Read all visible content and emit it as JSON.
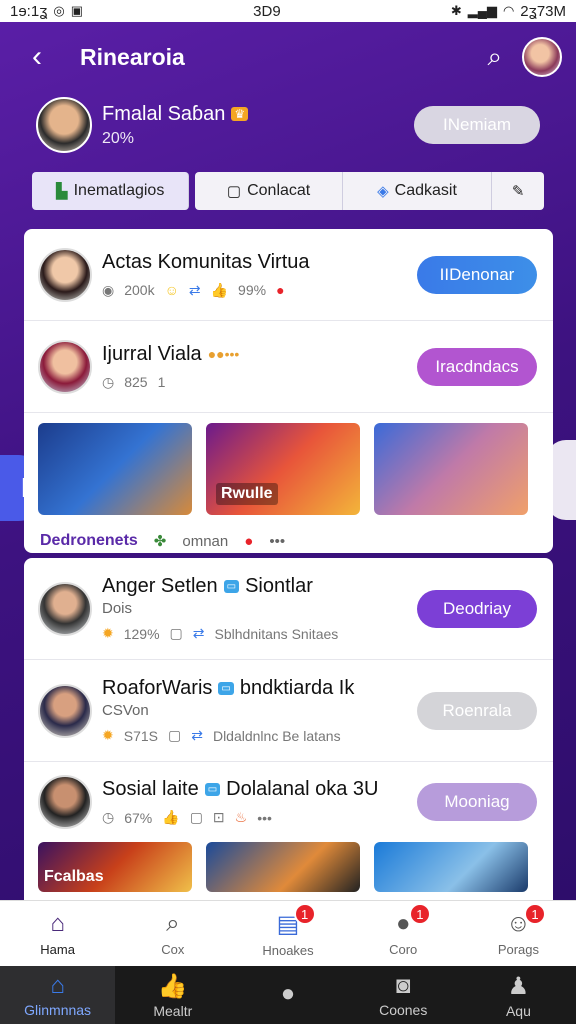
{
  "status": {
    "left": "1ɘ:1ʓ",
    "center": "3D9",
    "right": "2ʓ73M"
  },
  "header": {
    "title": "Rinearoia"
  },
  "profile": {
    "name": "Fmalal Saɓan",
    "sub": "20%",
    "action": "INemiam"
  },
  "tabs": [
    {
      "label": "Inematlagios",
      "icon": "b-icon"
    },
    {
      "label": "Conlacat",
      "icon": "calendar-icon"
    },
    {
      "label": "Cadkasit",
      "icon": "layers-icon"
    },
    {
      "label": "",
      "icon": "edit-icon"
    }
  ],
  "card1": {
    "rows": [
      {
        "title": "Actas Komunitas Virtua",
        "meta": [
          "200k",
          "99%"
        ],
        "action": "IIDenonar",
        "action_color": "blue"
      },
      {
        "title": "Ijurral Viala",
        "meta": [
          "825",
          "1"
        ],
        "action": "Iracdndacs",
        "action_color": "violet"
      }
    ],
    "thumbs": [
      {
        "label": ""
      },
      {
        "label": "Rwulle"
      },
      {
        "label": ""
      }
    ],
    "footer": {
      "strong": "Dedronenets",
      "text": "omnan"
    }
  },
  "card2": {
    "rows": [
      {
        "title": "Anger Setlen",
        "title_b": "Siontlar",
        "sub": "Dois",
        "meta": [
          "129%",
          "Sblhdnitans Snitaes"
        ],
        "action": "Deodriay",
        "action_color": "purple"
      },
      {
        "title": "RoaforWaris",
        "title_b": "bndktiarda Ik",
        "sub": "CSVon",
        "meta": [
          "S71S",
          "Dldaldnlnc Be latans"
        ],
        "action": "Roenrala",
        "action_color": "grey"
      },
      {
        "title": "Sosial laite",
        "title_b": "Dolalanal oka 3U",
        "sub": "",
        "meta": [
          "67%"
        ],
        "action": "Mooniag",
        "action_color": "lilac"
      }
    ],
    "thumbs": [
      {
        "label": "Fcalbas"
      },
      {
        "label": ""
      },
      {
        "label": ""
      }
    ]
  },
  "bottom_nav": [
    {
      "label": "Hama",
      "icon": "home-icon",
      "badge": ""
    },
    {
      "label": "Cox",
      "icon": "search-icon",
      "badge": ""
    },
    {
      "label": "Hnoakes",
      "icon": "notes-icon",
      "badge": "1"
    },
    {
      "label": "Coro",
      "icon": "chat-icon",
      "badge": "1"
    },
    {
      "label": "Porags",
      "icon": "profile-icon",
      "badge": "1"
    }
  ],
  "system_nav": [
    {
      "label": "Glinmnnas",
      "icon": "home-icon"
    },
    {
      "label": "Mealtr",
      "icon": "like-icon"
    },
    {
      "label": "",
      "icon": "circle-icon"
    },
    {
      "label": "Coones",
      "icon": "camera-icon"
    },
    {
      "label": "Aqu",
      "icon": "person-icon"
    }
  ]
}
